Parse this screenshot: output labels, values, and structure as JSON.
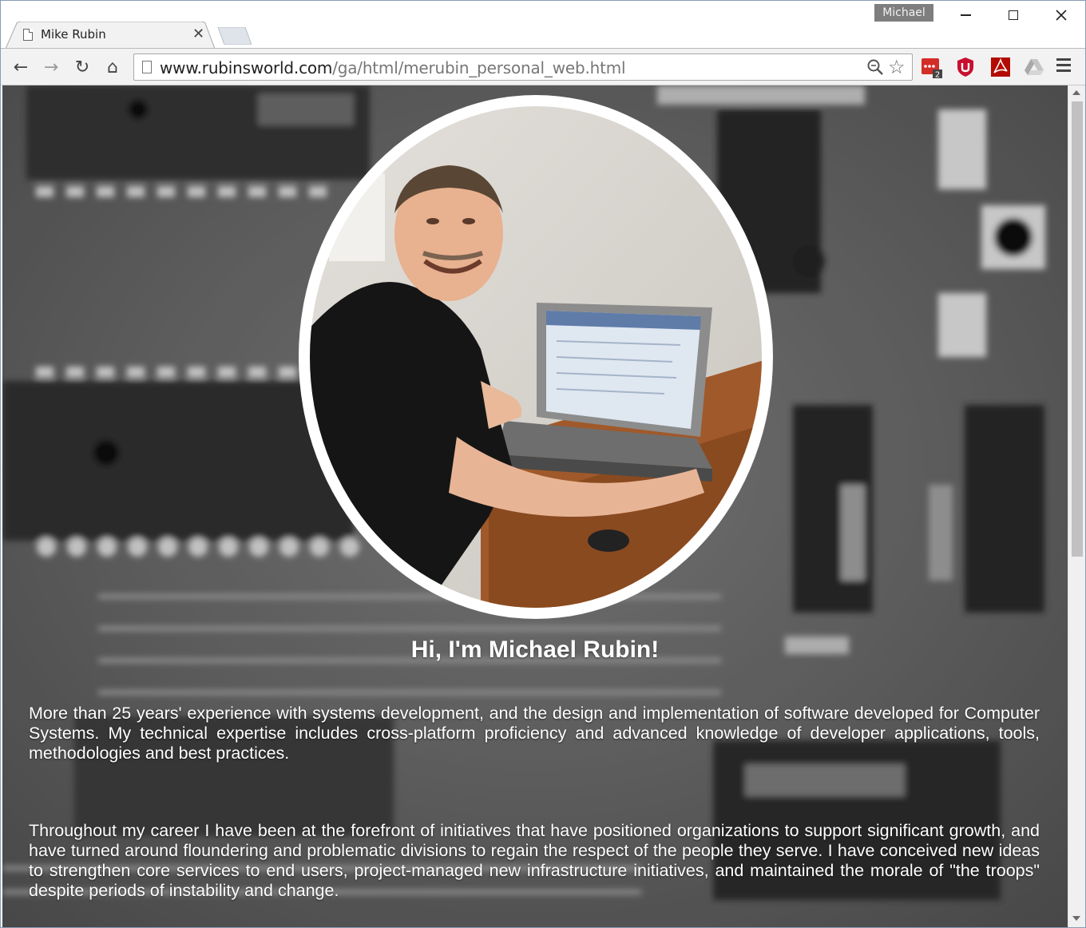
{
  "window": {
    "profile_name": "Michael"
  },
  "tab": {
    "title": "Mike Rubin",
    "close_glyph": "✕"
  },
  "toolbar": {
    "back_glyph": "←",
    "forward_glyph": "→",
    "reload_glyph": "↻",
    "home_glyph": "⌂",
    "url_host": "www.rubinsworld.com",
    "url_path": "/ga/html/merubin_personal_web.html",
    "star_glyph": "☆",
    "extensions": [
      "lastpass-icon",
      "ublock-icon",
      "acrobat-icon",
      "drive-icon"
    ],
    "lastpass_badge": "2"
  },
  "page": {
    "heading": "Hi, I'm Michael Rubin!",
    "paragraph_1": "More than 25 years' experience with systems development, and the design and implementation of software developed for Computer Systems. My technical expertise includes cross-platform proficiency and advanced knowledge of developer applications, tools, methodologies and best practices.",
    "paragraph_2": "Throughout my career I have been at the forefront of initiatives that have positioned organizations to support significant growth, and have turned around floundering and problematic divisions to regain the respect of the people they serve. I have conceived new ideas to strengthen core services to end users, project-managed new infrastructure initiatives, and maintained the morale of \"the troops\" despite periods of instability and change."
  },
  "colors": {
    "text": "#ffffff",
    "background_tone": "#6b6b6b",
    "ublock_red": "#c8102e",
    "lastpass_red": "#d32d27"
  }
}
